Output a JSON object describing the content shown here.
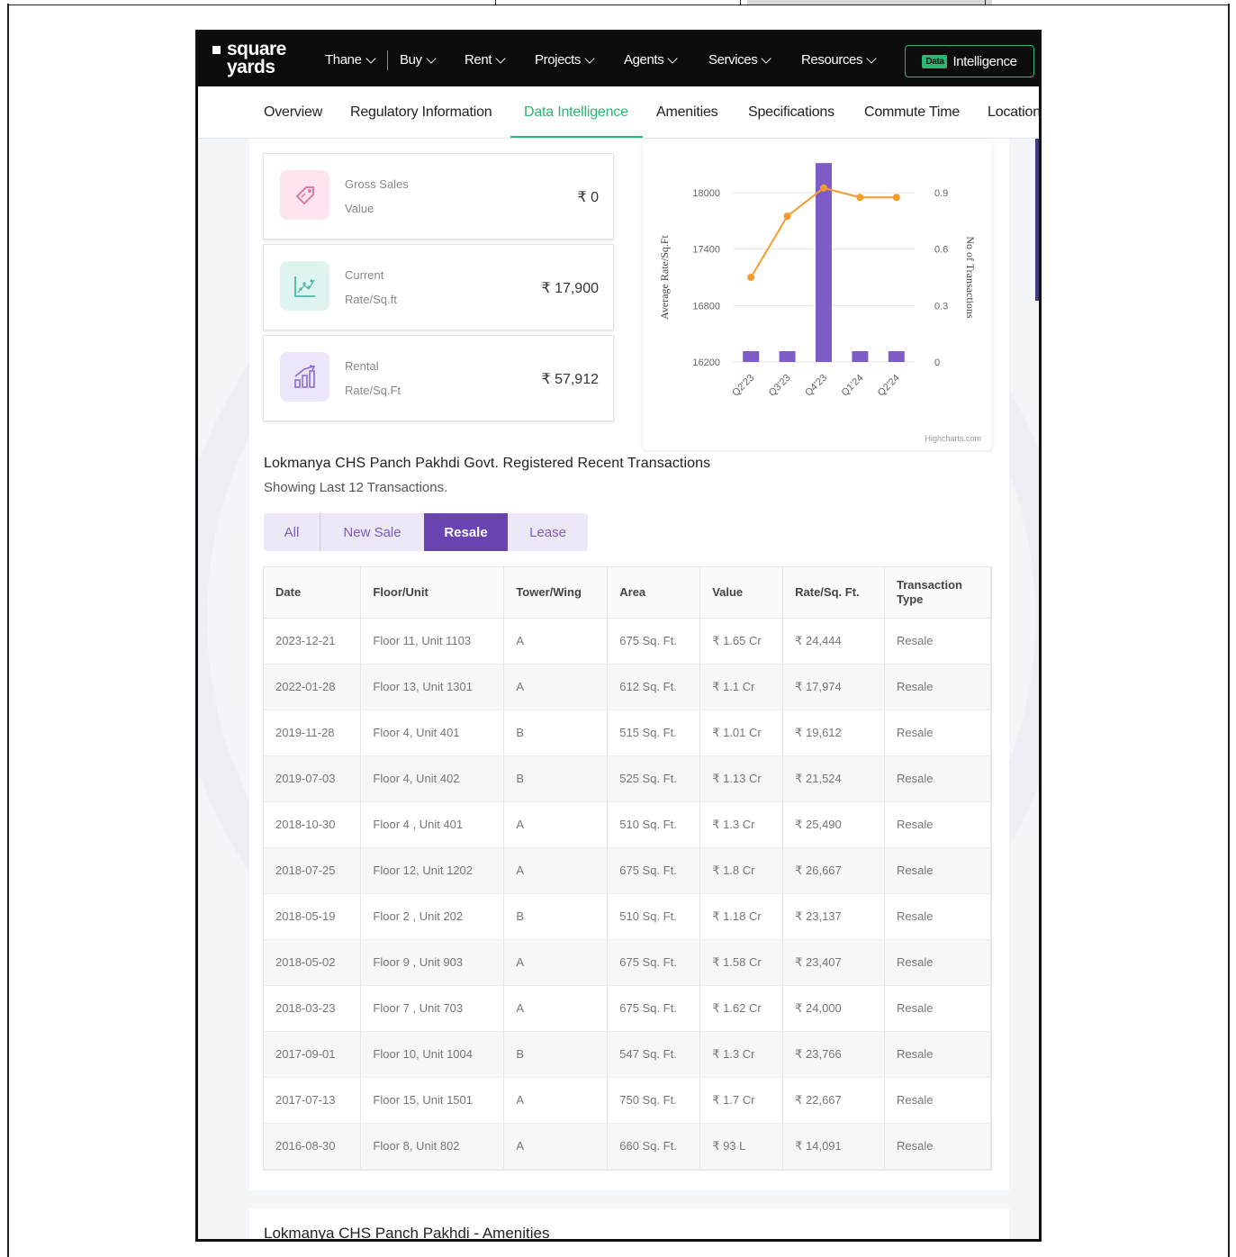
{
  "brand": {
    "line1": "square",
    "line2": "yards"
  },
  "nav": {
    "items": [
      {
        "label": "Thane"
      },
      {
        "label": "Buy"
      },
      {
        "label": "Rent"
      },
      {
        "label": "Projects"
      },
      {
        "label": "Agents"
      },
      {
        "label": "Services"
      },
      {
        "label": "Resources"
      }
    ],
    "cta_badge": "Data",
    "cta_label": "Intelligence"
  },
  "subnav": {
    "tabs": [
      "Overview",
      "Regulatory Information",
      "Data Intelligence",
      "Amenities",
      "Specifications",
      "Commute Time",
      "Location"
    ],
    "active": "Data Intelligence"
  },
  "stats": [
    {
      "label1": "Gross Sales",
      "label2": "Value",
      "value": "₹ 0",
      "icon": "price-tag-icon",
      "icon_bg": "#fde4ef",
      "icon_color": "#e27aa8"
    },
    {
      "label1": "Current",
      "label2": "Rate/Sq.ft",
      "value": "₹ 17,900",
      "icon": "chart-scatter-icon",
      "icon_bg": "#dff4f0",
      "icon_color": "#4cb8a6"
    },
    {
      "label1": "Rental",
      "label2": "Rate/Sq.Ft",
      "value": "₹ 57,912",
      "icon": "bar-growth-icon",
      "icon_bg": "#ece6fb",
      "icon_color": "#8a6ad6"
    }
  ],
  "chart_data": {
    "type": "bar",
    "categories": [
      "Q2'23",
      "Q3'23",
      "Q4'23",
      "Q1'24",
      "Q2'24"
    ],
    "series": [
      {
        "type": "line",
        "axis": "left",
        "color": "#f39c2c",
        "values": [
          17100,
          17750,
          18050,
          17950,
          17950
        ]
      },
      {
        "type": "bar",
        "axis": "right",
        "color": "#7d5cc6",
        "values": [
          0,
          0,
          1,
          0,
          0
        ]
      }
    ],
    "ylabel": "Average Rate/Sq.Ft",
    "y2label": "No of Transactions",
    "yticks": [
      "18000",
      "17400",
      "16800",
      "16200"
    ],
    "y2ticks": [
      "0.9",
      "0.6",
      "0.3",
      "0"
    ],
    "ylim": [
      16200,
      18000
    ],
    "y2lim": [
      0,
      0.9
    ],
    "credit": "Highcharts.com",
    "grid": true
  },
  "transactions": {
    "title": "Lokmanya CHS Panch Pakhdi Govt. Registered Recent Transactions",
    "subtitle": "Showing Last 12 Transactions.",
    "filters": [
      "All",
      "New Sale",
      "Resale",
      "Lease"
    ],
    "active_filter": "Resale",
    "headers": [
      "Date",
      "Floor/Unit",
      "Tower/Wing",
      "Area",
      "Value",
      "Rate/Sq. Ft.",
      "Transaction Type"
    ],
    "rows": [
      [
        "2023-12-21",
        "Floor 11, Unit 1103",
        "A",
        "675 Sq. Ft.",
        "₹ 1.65 Cr",
        "₹ 24,444",
        "Resale"
      ],
      [
        "2022-01-28",
        "Floor 13, Unit 1301",
        "A",
        "612 Sq. Ft.",
        "₹ 1.1 Cr",
        "₹ 17,974",
        "Resale"
      ],
      [
        "2019-11-28",
        "Floor 4, Unit 401",
        "B",
        "515 Sq. Ft.",
        "₹ 1.01 Cr",
        "₹ 19,612",
        "Resale"
      ],
      [
        "2019-07-03",
        "Floor 4, Unit 402",
        "B",
        "525 Sq. Ft.",
        "₹ 1.13 Cr",
        "₹ 21,524",
        "Resale"
      ],
      [
        "2018-10-30",
        "Floor 4 , Unit 401",
        "A",
        "510 Sq. Ft.",
        "₹ 1.3 Cr",
        "₹ 25,490",
        "Resale"
      ],
      [
        "2018-07-25",
        "Floor 12, Unit 1202",
        "A",
        "675 Sq. Ft.",
        "₹ 1.8 Cr",
        "₹ 26,667",
        "Resale"
      ],
      [
        "2018-05-19",
        "Floor 2 , Unit 202",
        "B",
        "510 Sq. Ft.",
        "₹ 1.18 Cr",
        "₹ 23,137",
        "Resale"
      ],
      [
        "2018-05-02",
        "Floor 9 , Unit 903",
        "A",
        "675 Sq. Ft.",
        "₹ 1.58 Cr",
        "₹ 23,407",
        "Resale"
      ],
      [
        "2018-03-23",
        "Floor 7 , Unit 703",
        "A",
        "675 Sq. Ft.",
        "₹ 1.62 Cr",
        "₹ 24,000",
        "Resale"
      ],
      [
        "2017-09-01",
        "Floor 10, Unit 1004",
        "B",
        "547 Sq. Ft.",
        "₹ 1.3 Cr",
        "₹ 23,766",
        "Resale"
      ],
      [
        "2017-07-13",
        "Floor 15, Unit 1501",
        "A",
        "750 Sq. Ft.",
        "₹ 1.7 Cr",
        "₹ 22,667",
        "Resale"
      ],
      [
        "2016-08-30",
        "Floor 8, Unit 802",
        "A",
        "660 Sq. Ft.",
        "₹ 93 L",
        "₹ 14,091",
        "Resale"
      ]
    ]
  },
  "amenities": {
    "title": "Lokmanya CHS Panch Pakhdi - Amenities"
  }
}
